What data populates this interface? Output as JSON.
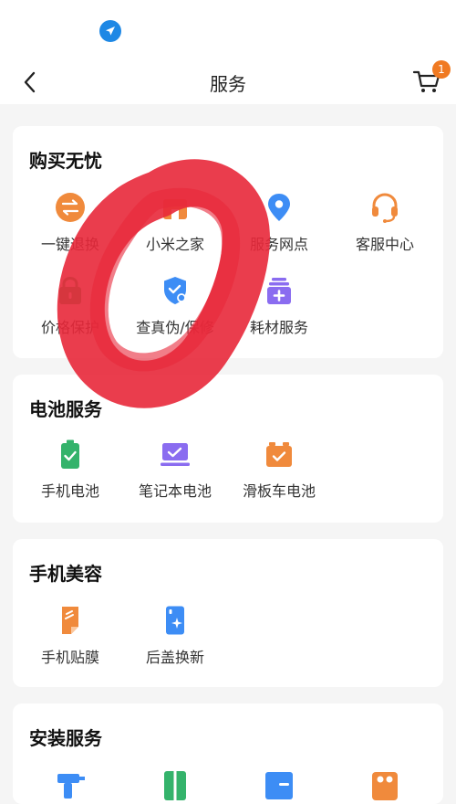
{
  "header": {
    "title": "服务",
    "cart_badge": "1",
    "location_icon": "navigation-arrow-icon",
    "back_icon": "chevron-left-icon",
    "cart_icon": "shopping-cart-icon"
  },
  "colors": {
    "accent_orange": "#f08a3c",
    "accent_blue": "#3d8df5",
    "accent_green": "#34b36b",
    "accent_purple": "#8a6cf0",
    "scribble_red": "#e8283a"
  },
  "sections": [
    {
      "title": "购买无忧",
      "items": [
        {
          "label": "一键退换",
          "icon": "exchange-icon"
        },
        {
          "label": "小米之家",
          "icon": "store-icon"
        },
        {
          "label": "服务网点",
          "icon": "location-pin-icon"
        },
        {
          "label": "客服中心",
          "icon": "headset-icon"
        },
        {
          "label": "价格保护",
          "icon": "price-lock-icon"
        },
        {
          "label": "查真伪/保修",
          "icon": "shield-check-icon"
        },
        {
          "label": "耗材服务",
          "icon": "consumables-icon"
        }
      ]
    },
    {
      "title": "电池服务",
      "items": [
        {
          "label": "手机电池",
          "icon": "phone-battery-icon"
        },
        {
          "label": "笔记本电池",
          "icon": "laptop-battery-icon"
        },
        {
          "label": "滑板车电池",
          "icon": "scooter-battery-icon"
        }
      ]
    },
    {
      "title": "手机美容",
      "items": [
        {
          "label": "手机贴膜",
          "icon": "screen-film-icon"
        },
        {
          "label": "后盖换新",
          "icon": "back-cover-icon"
        }
      ]
    },
    {
      "title": "安装服务",
      "items": [
        {
          "label": "",
          "icon": "drill-icon"
        },
        {
          "label": "",
          "icon": "fridge-icon"
        },
        {
          "label": "",
          "icon": "air-conditioner-icon"
        },
        {
          "label": "",
          "icon": "appliance-icon"
        }
      ]
    }
  ]
}
